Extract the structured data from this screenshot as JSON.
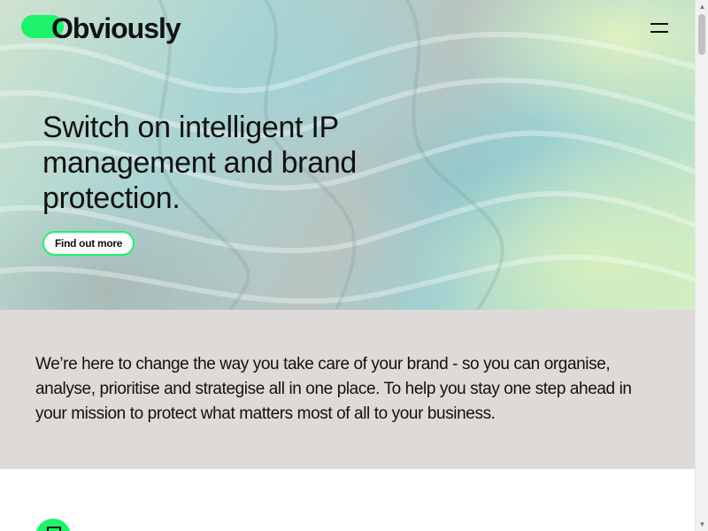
{
  "header": {
    "logo_text": "Obviously",
    "menu_icon": "hamburger-icon"
  },
  "hero": {
    "headline": "Switch on intelligent IP management and brand protection.",
    "cta_label": "Find out more"
  },
  "intro": {
    "text": "We’re here to change the way you take care of your brand - so you can organise, analyse, prioritise and strategise all in one place. To help you stay one step ahead in your mission to protect what matters most of all to your business."
  },
  "feature": {
    "icon": "document-icon"
  },
  "scrollbar": {
    "up_icon": "▲",
    "down_icon": "▼"
  },
  "colors": {
    "accent": "#1ef26a",
    "intro_background": "#dedad7",
    "text": "#111111"
  }
}
